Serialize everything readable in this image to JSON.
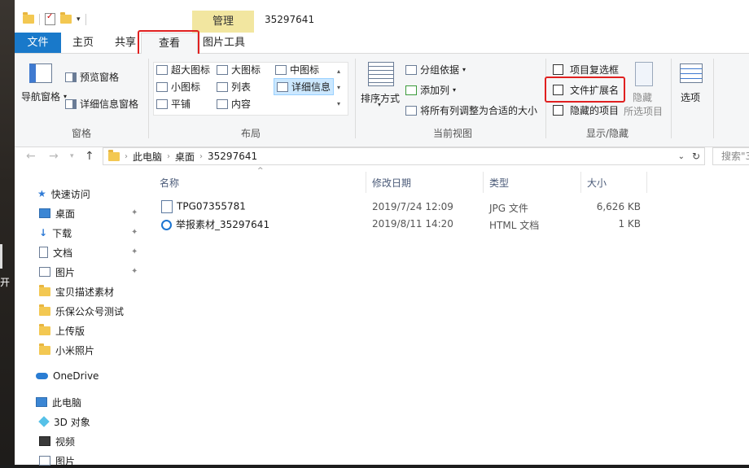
{
  "desktop": {
    "left_text": "开"
  },
  "title": {
    "manage_tab": "管理",
    "window_title": "35297641"
  },
  "menu": {
    "file": "文件",
    "home": "主页",
    "share": "共享",
    "view": "查看",
    "picture_tools": "图片工具"
  },
  "ribbon": {
    "panes": {
      "nav_pane": "导航窗格",
      "preview_pane": "预览窗格",
      "details_pane": "详细信息窗格",
      "label": "窗格"
    },
    "layout": {
      "items": [
        "超大图标",
        "大图标",
        "中图标",
        "小图标",
        "列表",
        "详细信息",
        "平铺",
        "内容"
      ],
      "label": "布局"
    },
    "current_view": {
      "sort_by": "排序方式",
      "group_by": "分组依据",
      "add_column": "添加列",
      "size_all_columns": "将所有列调整为合适的大小",
      "label": "当前视图"
    },
    "show_hide": {
      "item_checkboxes": "项目复选框",
      "file_extensions": "文件扩展名",
      "hidden_items": "隐藏的项目",
      "hide": "隐藏",
      "hide_selected": "所选项目",
      "label": "显示/隐藏"
    },
    "options": "选项"
  },
  "address": {
    "path": [
      "此电脑",
      "桌面",
      "35297641"
    ],
    "search_placeholder": "搜索\"3"
  },
  "sidebar": {
    "quick_access": "快速访问",
    "items": [
      "桌面",
      "下载",
      "文档",
      "图片",
      "宝贝描述素材",
      "乐保公众号测试",
      "上传版",
      "小米照片"
    ],
    "onedrive": "OneDrive",
    "this_pc": "此电脑",
    "pc_items": [
      "3D 对象",
      "视频",
      "图片"
    ]
  },
  "columns": {
    "name": "名称",
    "date": "修改日期",
    "type": "类型",
    "size": "大小"
  },
  "files": [
    {
      "name": "TPG07355781",
      "date": "2019/7/24 12:09",
      "type": "JPG 文件",
      "size": "6,626 KB"
    },
    {
      "name": "举报素材_35297641",
      "date": "2019/8/11 14:20",
      "type": "HTML 文档",
      "size": "1 KB"
    }
  ]
}
